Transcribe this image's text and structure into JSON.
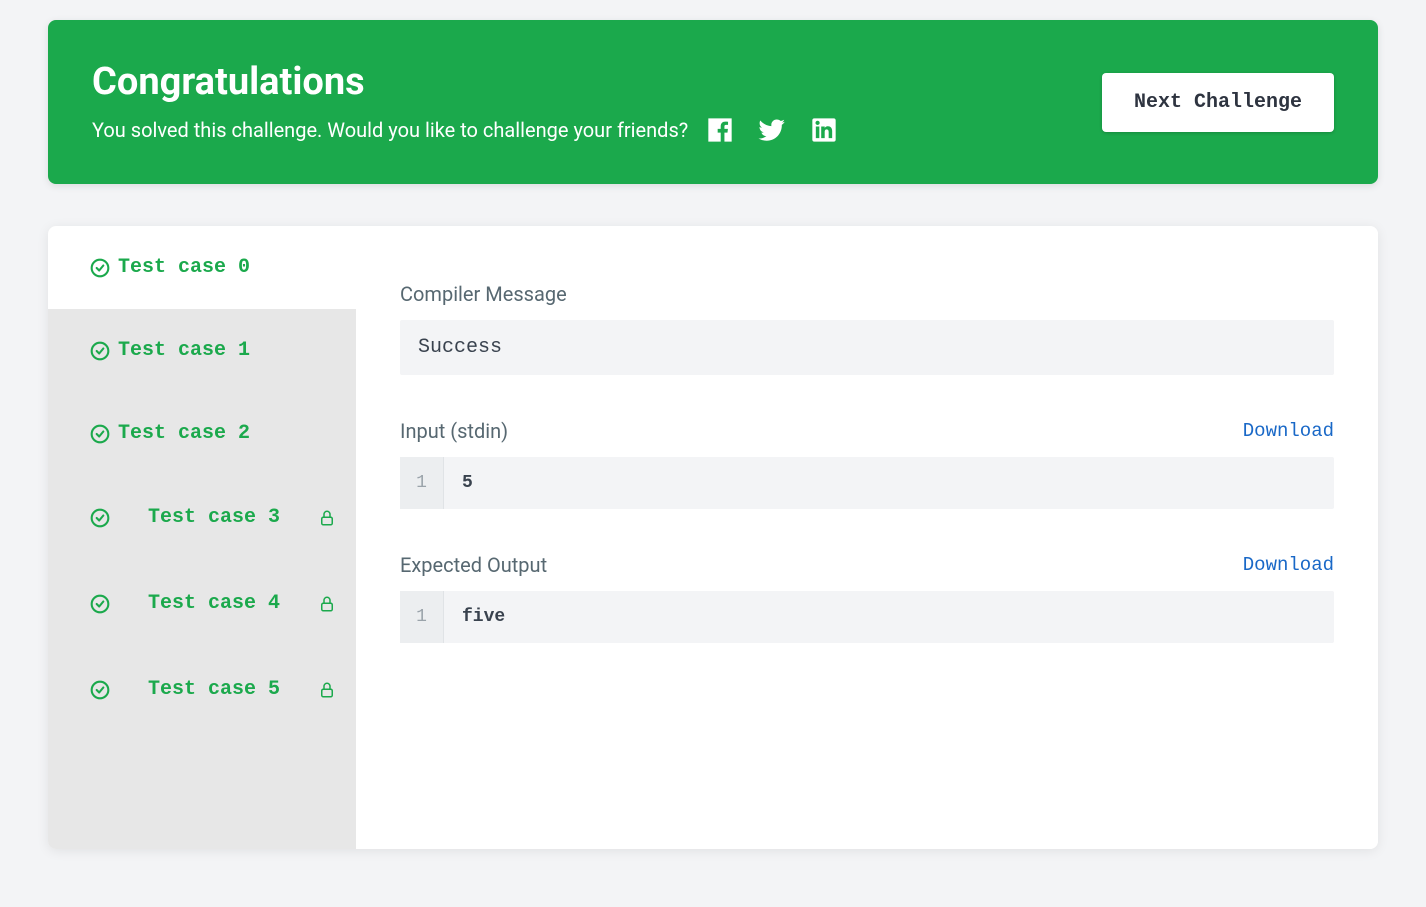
{
  "banner": {
    "title": "Congratulations",
    "subtitle": "You solved this challenge. Would you like to challenge your friends?",
    "next_button": "Next Challenge"
  },
  "sidebar": {
    "testcases": [
      {
        "label": "Test case 0",
        "locked": false,
        "active": true
      },
      {
        "label": "Test case 1",
        "locked": false,
        "active": false
      },
      {
        "label": "Test case 2",
        "locked": false,
        "active": false
      },
      {
        "label": "Test case 3",
        "locked": true,
        "active": false
      },
      {
        "label": "Test case 4",
        "locked": true,
        "active": false
      },
      {
        "label": "Test case 5",
        "locked": true,
        "active": false
      }
    ]
  },
  "detail": {
    "compiler_label": "Compiler Message",
    "compiler_message": "Success",
    "input_label": "Input (stdin)",
    "input_download": "Download",
    "input_line_number": "1",
    "input_content": "5",
    "output_label": "Expected Output",
    "output_download": "Download",
    "output_line_number": "1",
    "output_content": "five"
  },
  "colors": {
    "green": "#1ba94c",
    "link_blue": "#1968c7"
  }
}
